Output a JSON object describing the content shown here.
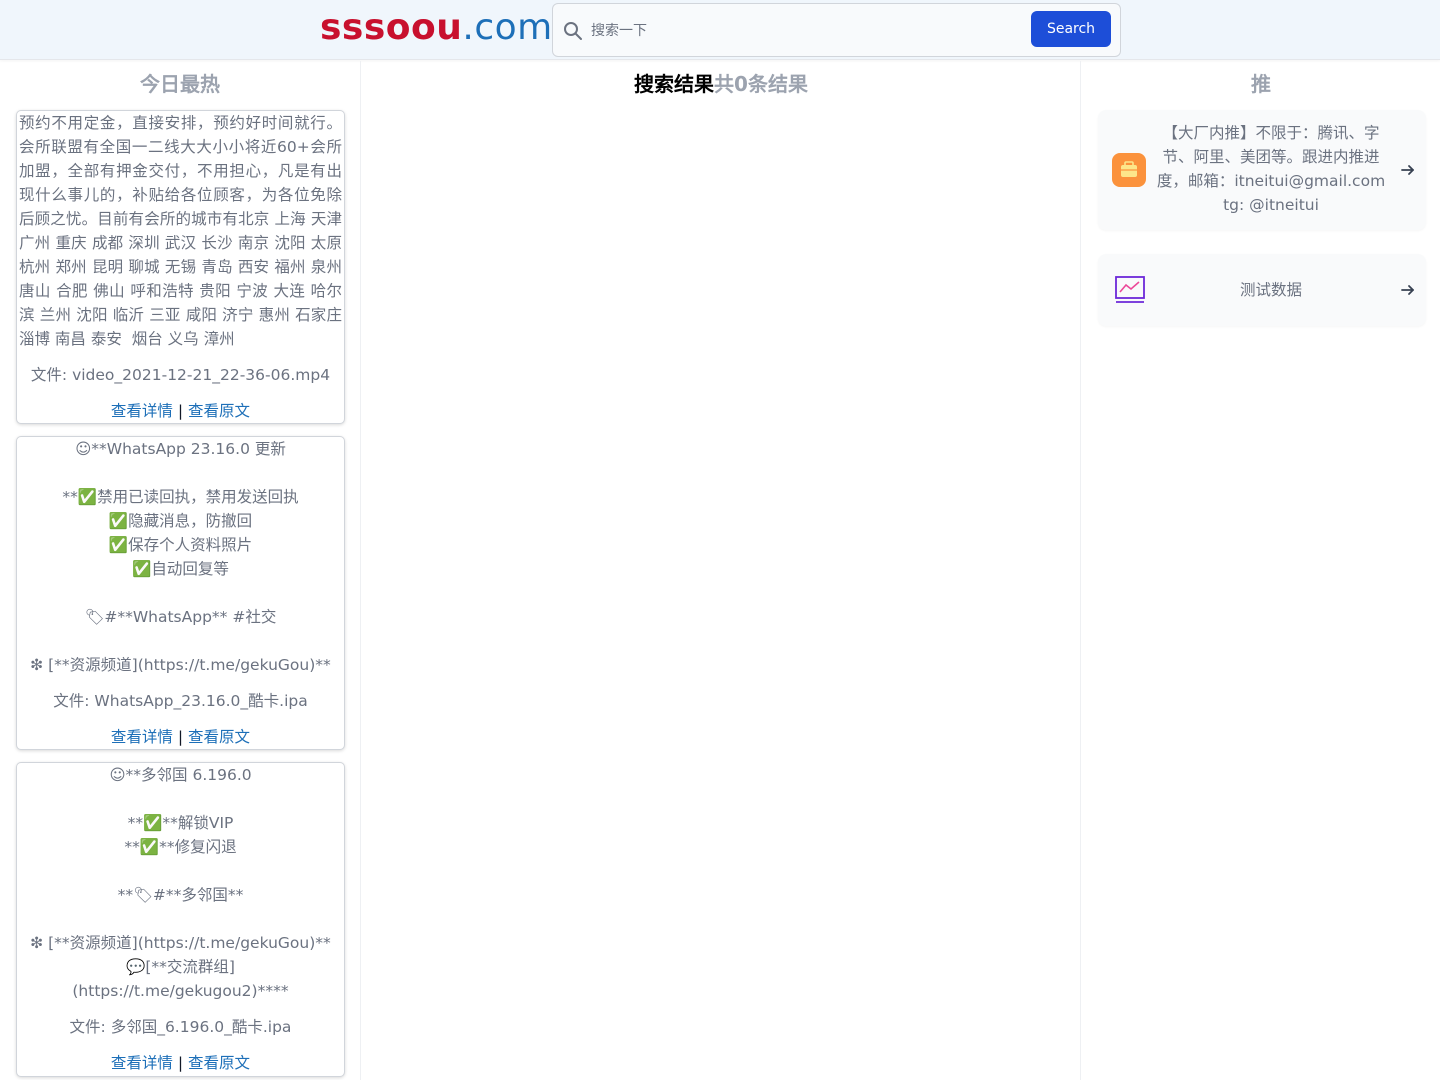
{
  "header": {
    "logo_part1": "sssoou",
    "logo_part2": ".com",
    "search_placeholder": "搜索一下",
    "search_button": "Search",
    "search_icon": "search-icon"
  },
  "left": {
    "title": "今日最热",
    "cards": [
      {
        "text": "预约不用定金，直接安排，预约好时间就行。会所联盟有全国一二线大大小小将近60+会所加盟，全部有押金交付，不用担心，凡是有出现什么事儿的，补贴给各位顾客，为各位免除后顾之忧。目前有会所的城市有北京 上海 天津 广州 重庆 成都 深圳 武汉 长沙 南京 沈阳 太原 杭州 郑州 昆明 聊城 无锡 青岛 西安 福州 泉州 唐山 合肥 佛山 呼和浩特 贵阳 宁波 大连 哈尔滨 兰州 沈阳 临沂 三亚 咸阳 济宁 惠州 石家庄 淄博 南昌 泰安  烟台 义乌 漳州",
        "file": "文件: video_2021-12-21_22-36-06.mp4",
        "link_detail": "查看详情",
        "separator": "|",
        "link_source": "查看原文"
      },
      {
        "text": "☺**WhatsApp 23.16.0 更新\n\n**✅禁用已读回执，禁用发送回执\n✅隐藏消息，防撤回\n✅保存个人资料照片\n✅自动回复等\n\n🏷#**WhatsApp** #社交\n\n❇ [**资源频道](https://t.me/gekuGou)**",
        "file": "文件: WhatsApp_23.16.0_酷卡.ipa",
        "link_detail": "查看详情",
        "separator": "|",
        "link_source": "查看原文"
      },
      {
        "text": "☺**多邻国 6.196.0\n\n**✅**解锁VIP\n**✅**修复闪退\n\n**🏷#**多邻国**\n\n❇ [**资源频道](https://t.me/gekuGou)**\n💬[**交流群组]\n(https://t.me/gekugou2)****",
        "file": "文件: 多邻国_6.196.0_酷卡.ipa",
        "link_detail": "查看详情",
        "separator": "|",
        "link_source": "查看原文"
      }
    ]
  },
  "center": {
    "title": "搜索结果",
    "count": "共0条结果"
  },
  "right": {
    "title": "推",
    "items": [
      {
        "icon": "briefcase-icon",
        "text": "【大厂内推】不限于：腾讯、字节、阿里、美团等。跟进内推进度，邮箱：itneitui@gmail.com tg: @itneitui",
        "arrow": "arrow-right-icon"
      },
      {
        "icon": "chart-icon",
        "text": "测试数据",
        "arrow": "arrow-right-icon"
      }
    ]
  },
  "colors": {
    "logo_red": "#c8102e",
    "logo_blue": "#1d6fb8",
    "button_blue": "#1d4ed8",
    "link_blue": "#1d6fb8",
    "icon_orange": "#fb923c",
    "chart_purple": "#6d28d9"
  }
}
